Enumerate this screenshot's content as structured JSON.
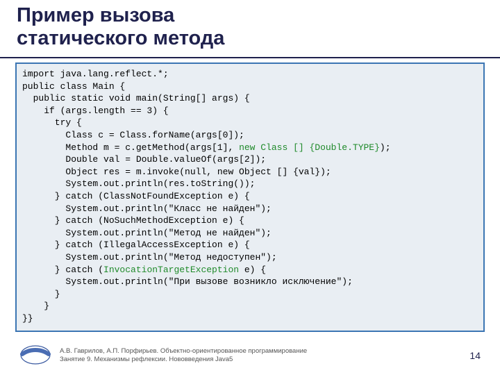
{
  "title_line1": "Пример вызова",
  "title_line2": "статического метода",
  "code": {
    "l01": "import java.lang.reflect.*;",
    "l02": "public class Main {",
    "l03": "  public static void main(String[] args) {",
    "l04": "    if (args.length == 3) {",
    "l05": "      try {",
    "l06": "        Class c = Class.forName(args[0]);",
    "l07a": "        Method m = c.getMethod(args[1], ",
    "l07hl": "new Class [] {Double.TYPE}",
    "l07b": ");",
    "l08": "        Double val = Double.valueOf(args[2]);",
    "l09": "        Object res = m.invoke(null, new Object [] {val});",
    "l10": "        System.out.println(res.toString());",
    "l11": "      } catch (ClassNotFoundException e) {",
    "l12": "        System.out.println(\"Класс не найден\");",
    "l13": "      } catch (NoSuchMethodException e) {",
    "l14": "        System.out.println(\"Метод не найден\");",
    "l15": "      } catch (IllegalAccessException e) {",
    "l16": "        System.out.println(\"Метод недоступен\");",
    "l17a": "      } catch (",
    "l17hl": "InvocationTargetException",
    "l17b": " e) {",
    "l18": "        System.out.println(\"При вызове возникло исключение\");",
    "l19": "      }",
    "l20": "    }",
    "l21": "}}"
  },
  "footer": {
    "line1": "А.В. Гаврилов, А.П. Порфирьев. Объектно-ориентированное программирование",
    "line2": "Занятие 9. Механизмы рефлексии. Нововведения Java5"
  },
  "page_number": "14"
}
